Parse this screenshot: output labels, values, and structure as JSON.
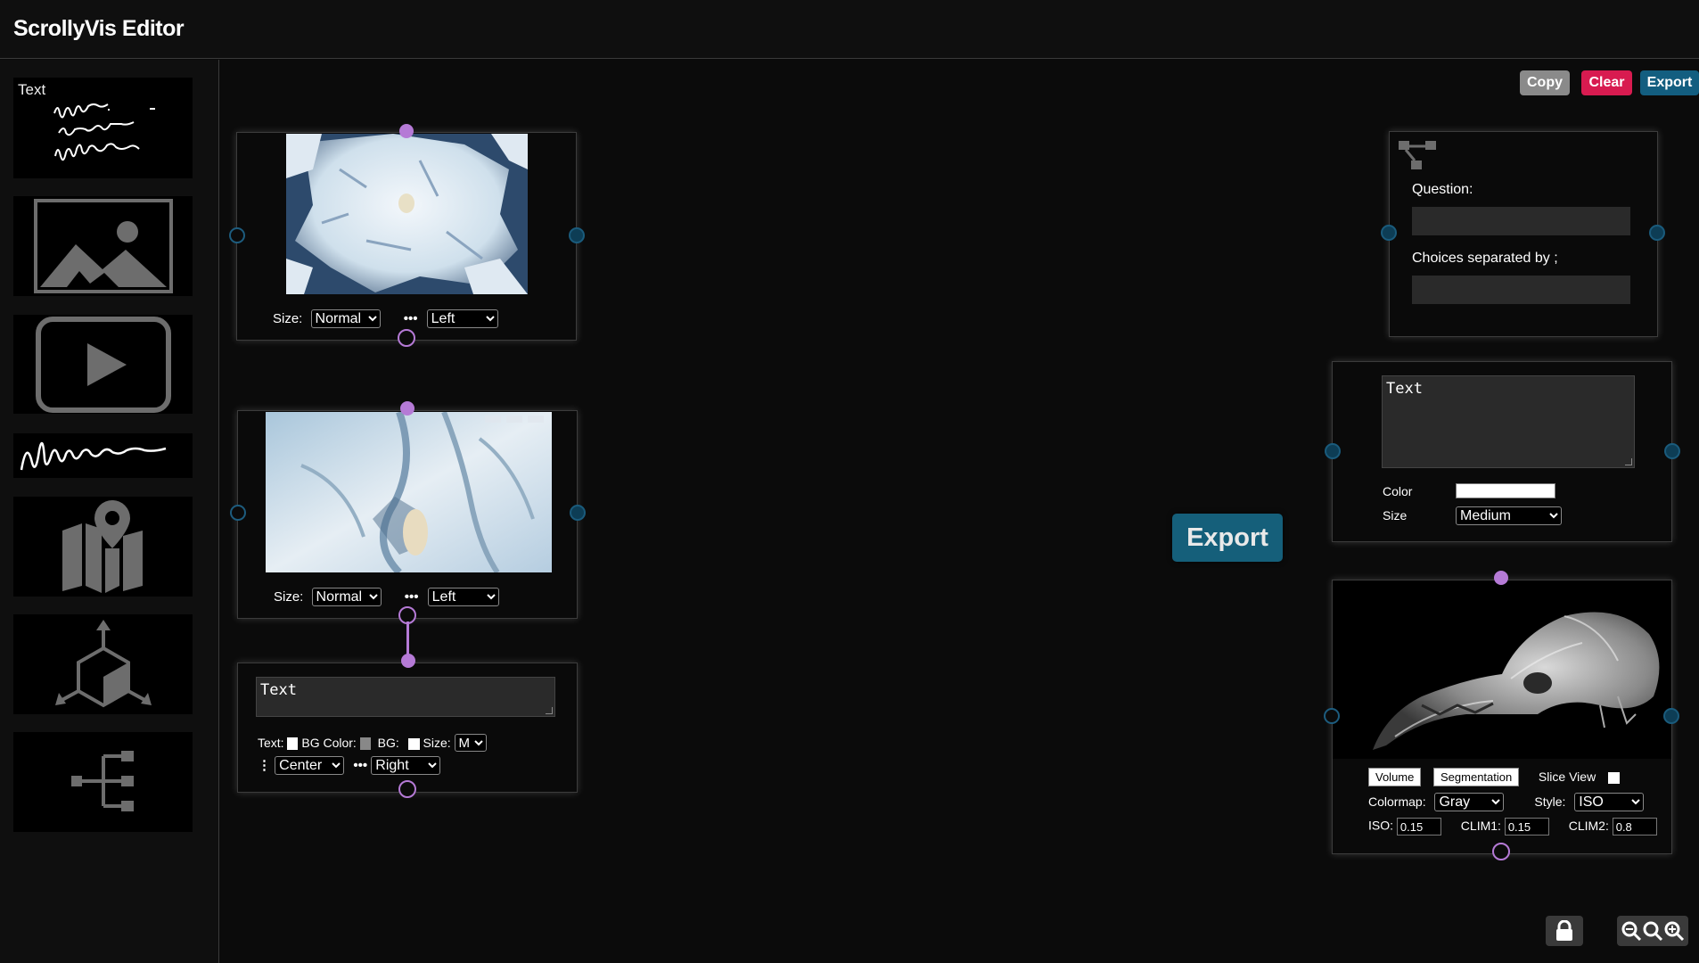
{
  "app": {
    "title": "ScrollyVis Editor"
  },
  "sidebar": {
    "items": [
      {
        "label": "Text",
        "icon": "handwriting-text-icon"
      },
      {
        "icon": "image-icon"
      },
      {
        "icon": "video-play-icon"
      },
      {
        "icon": "signature-icon"
      },
      {
        "icon": "map-pin-icon"
      },
      {
        "icon": "3d-cube-icon"
      },
      {
        "icon": "tree-structure-icon"
      }
    ]
  },
  "toolbar": {
    "copy": "Copy",
    "clear": "Clear",
    "export": "Export",
    "copy_color": "#8a8a8a",
    "clear_color": "#d81b50",
    "export_color": "#135e80"
  },
  "image_node_1": {
    "size_label": "Size:",
    "size_value": "Normal",
    "align_value": "Left"
  },
  "image_node_2": {
    "size_label": "Size:",
    "size_value": "Normal",
    "align_value": "Left"
  },
  "text_node_left": {
    "text": "Text",
    "text_color_label": "Text:",
    "bg_color_label": "BG Color:",
    "bg_label": "BG:",
    "size_label": "Size:",
    "size_value": "M",
    "v_align_value": "Center",
    "h_align_value": "Right"
  },
  "quiz_node": {
    "question_label": "Question:",
    "choices_label": "Choices separated by ;",
    "question_value": "",
    "choices_value": ""
  },
  "text_node_right": {
    "text": "Text",
    "color_label": "Color",
    "size_label": "Size",
    "size_value": "Medium",
    "color_value": "#ffffff"
  },
  "volume_node": {
    "volume_button": "Volume",
    "segmentation_button": "Segmentation",
    "slice_view_label": "Slice View",
    "colormap_label": "Colormap:",
    "colormap_value": "Gray",
    "style_label": "Style:",
    "style_value": "ISO",
    "iso_label": "ISO:",
    "iso_value": "0.15",
    "clim1_label": "CLIM1:",
    "clim1_value": "0.15",
    "clim2_label": "CLIM2:",
    "clim2_value": "0.8"
  },
  "export_big": "Export",
  "accent_colors": {
    "purple": "#b57ad6",
    "blue": "#1a5b7c"
  }
}
